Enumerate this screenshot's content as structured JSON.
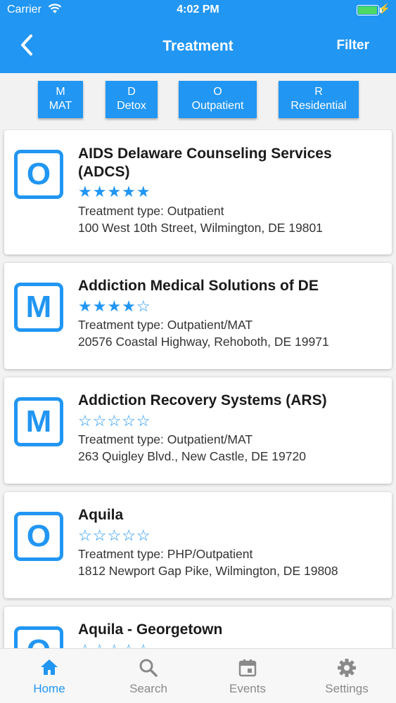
{
  "status_bar": {
    "carrier": "Carrier",
    "time": "4:02 PM"
  },
  "header": {
    "title": "Treatment",
    "filter_label": "Filter"
  },
  "chips": [
    {
      "letter": "M",
      "label": "MAT"
    },
    {
      "letter": "D",
      "label": "Detox"
    },
    {
      "letter": "O",
      "label": "Outpatient"
    },
    {
      "letter": "R",
      "label": "Residential"
    }
  ],
  "facilities": [
    {
      "letter": "O",
      "name": "AIDS Delaware Counseling Services (ADCS)",
      "rating": 5,
      "type": "Treatment type: Outpatient",
      "address": "100 West 10th Street, Wilmington, DE 19801"
    },
    {
      "letter": "M",
      "name": "Addiction Medical Solutions of DE",
      "rating": 4,
      "type": "Treatment type: Outpatient/MAT",
      "address": "20576 Coastal Highway, Rehoboth, DE 19971"
    },
    {
      "letter": "M",
      "name": "Addiction Recovery Systems (ARS)",
      "rating": 0,
      "type": "Treatment type: Outpatient/MAT",
      "address": "263 Quigley Blvd., New Castle, DE 19720"
    },
    {
      "letter": "O",
      "name": "Aquila",
      "rating": 0,
      "type": "Treatment type: PHP/Outpatient",
      "address": "1812 Newport Gap Pike, Wilmington, DE 19808"
    },
    {
      "letter": "O",
      "name": "Aquila - Georgetown",
      "rating": 0,
      "type": "",
      "address": ""
    }
  ],
  "tabs": [
    {
      "label": "Home",
      "icon": "home-icon",
      "active": true
    },
    {
      "label": "Search",
      "icon": "search-icon",
      "active": false
    },
    {
      "label": "Events",
      "icon": "calendar-icon",
      "active": false
    },
    {
      "label": "Settings",
      "icon": "gear-icon",
      "active": false
    }
  ],
  "colors": {
    "primary": "#2196f3",
    "inactive_tab": "#8a8a8a",
    "battery": "#4cd964"
  }
}
